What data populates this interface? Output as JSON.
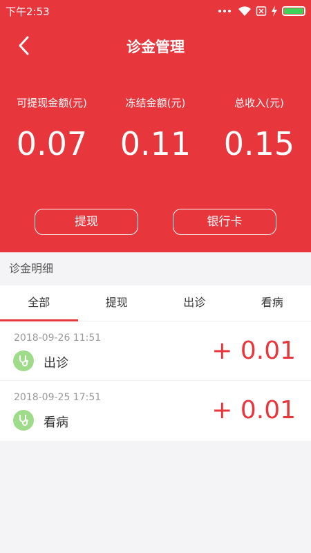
{
  "status_bar": {
    "time": "下午2:53",
    "icons": [
      "more-dots-icon",
      "wifi-icon",
      "sim-card-icon",
      "charging-icon",
      "battery-icon"
    ]
  },
  "header": {
    "title": "诊金管理",
    "back_icon": "back-arrow-icon",
    "background_color": "#e8363d"
  },
  "stats": [
    {
      "label": "可提现金额(元)",
      "value": "0.07"
    },
    {
      "label": "冻结金额(元)",
      "value": "0.11"
    },
    {
      "label": "总收入(元)",
      "value": "0.15"
    }
  ],
  "actions": {
    "withdraw_label": "提现",
    "bank_card_label": "银行卡"
  },
  "details": {
    "section_title": "诊金明细",
    "tabs": [
      {
        "label": "全部",
        "active": true
      },
      {
        "label": "提现",
        "active": false
      },
      {
        "label": "出诊",
        "active": false
      },
      {
        "label": "看病",
        "active": false
      }
    ],
    "records": [
      {
        "datetime": "2018-09-26 11:51",
        "type": "出诊",
        "amount": "+ 0.01",
        "icon": "stethoscope-icon"
      },
      {
        "datetime": "2018-09-25 17:51",
        "type": "看病",
        "amount": "+ 0.01",
        "icon": "stethoscope-icon"
      }
    ]
  },
  "colors": {
    "accent": "#e8363d",
    "icon_badge": "#9fdc89",
    "battery": "#3ed25b"
  }
}
